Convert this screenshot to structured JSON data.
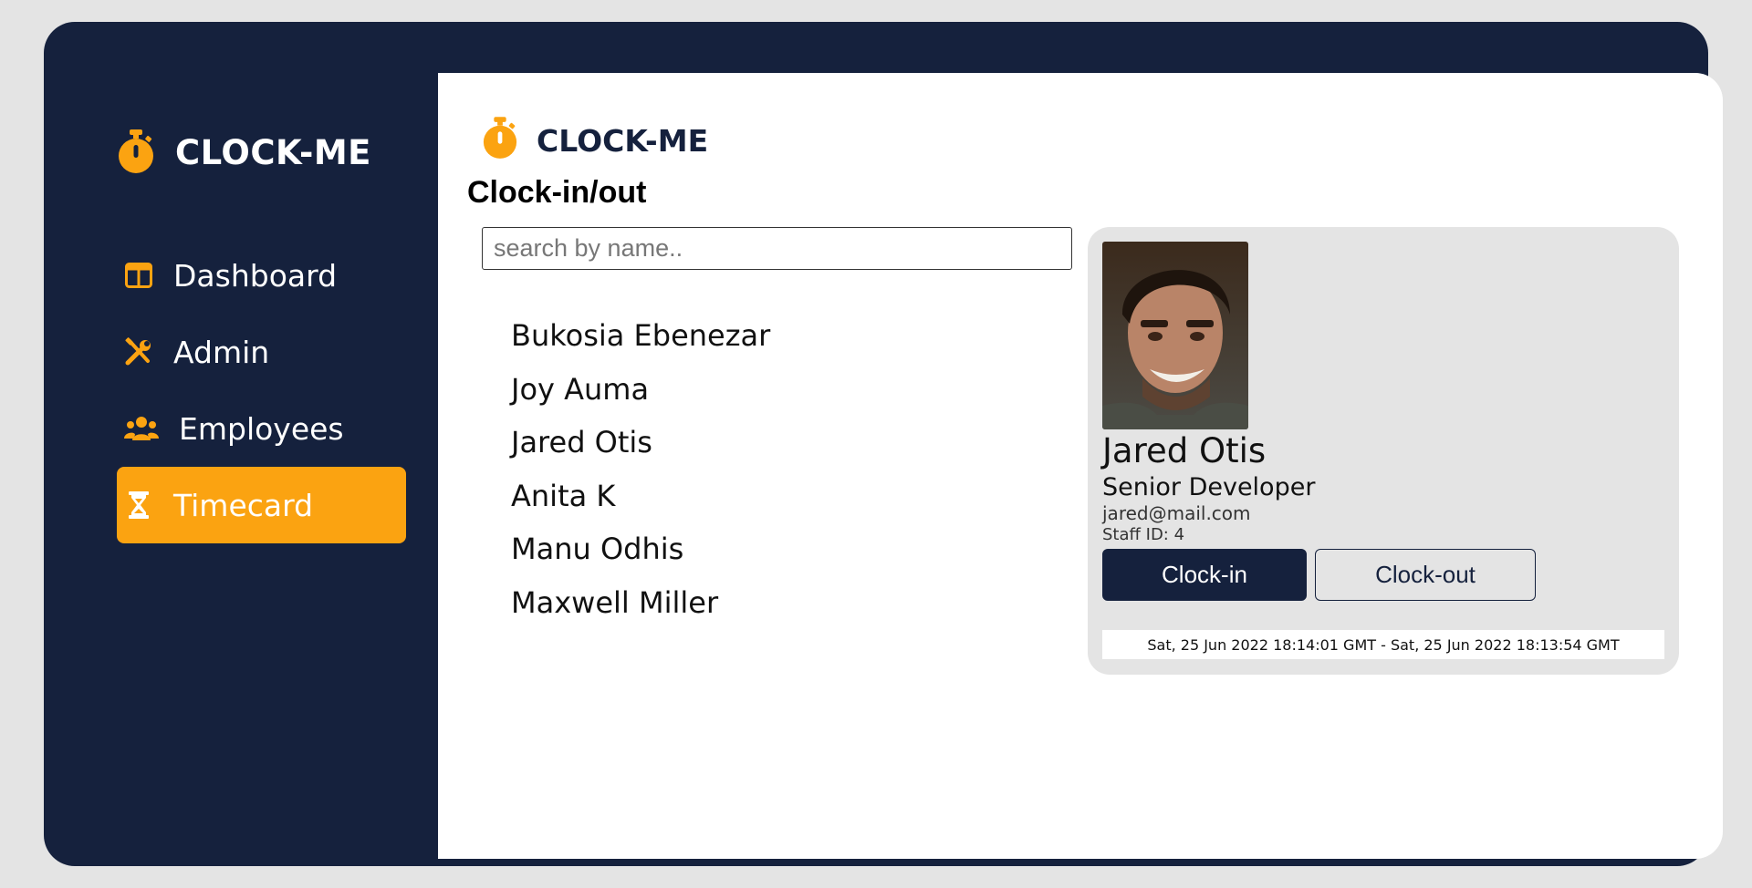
{
  "brand": {
    "name": "CLOCK-ME",
    "icon": "stopwatch-icon",
    "accent_color": "#fba311",
    "dark_color": "#15213d"
  },
  "sidebar": {
    "items": [
      {
        "label": "Dashboard",
        "icon": "dashboard-icon",
        "active": false
      },
      {
        "label": "Admin",
        "icon": "tools-icon",
        "active": false
      },
      {
        "label": "Employees",
        "icon": "users-icon",
        "active": false
      },
      {
        "label": "Timecard",
        "icon": "hourglass-icon",
        "active": true
      }
    ]
  },
  "main": {
    "brand": "CLOCK-ME",
    "title": "Clock-in/out",
    "search": {
      "placeholder": "search by name..",
      "value": ""
    },
    "employees": [
      "Bukosia Ebenezar",
      "Joy Auma",
      "Jared Otis",
      "Anita K",
      "Manu Odhis",
      "Maxwell Miller"
    ]
  },
  "profile": {
    "name": "Jared Otis",
    "role": "Senior Developer",
    "email": "jared@mail.com",
    "staff_id": "Staff ID: 4",
    "clock_in_label": "Clock-in",
    "clock_out_label": "Clock-out",
    "time_range": "Sat, 25 Jun 2022 18:14:01 GMT - Sat, 25 Jun 2022 18:13:54 GMT"
  }
}
